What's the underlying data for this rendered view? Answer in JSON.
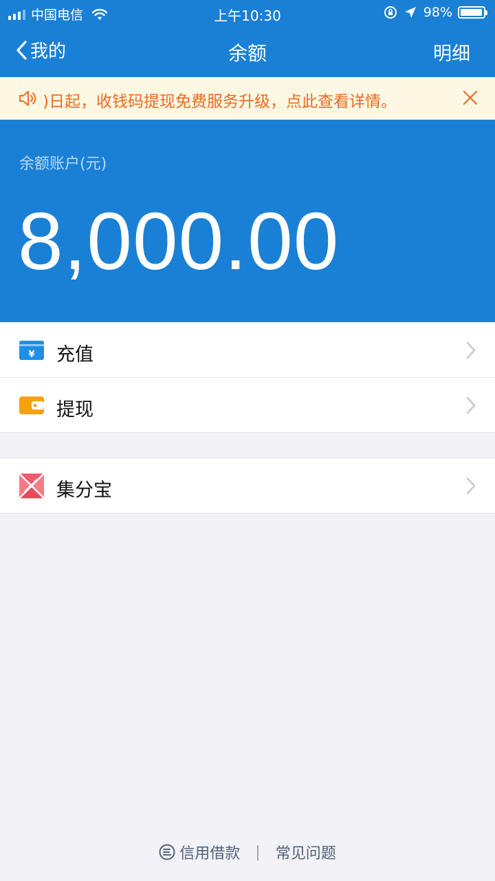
{
  "status_bar": {
    "carrier": "中国电信",
    "time": "上午10:30",
    "battery": "98%"
  },
  "nav": {
    "back_label": "我的",
    "title": "余额",
    "right_label": "明细"
  },
  "notice": {
    "text": ")日起，收钱码提现免费服务升级，点此查看详情。"
  },
  "balance": {
    "label": "余额账户(元)",
    "amount": "8,000.00"
  },
  "list_group_1": [
    {
      "label": "充值",
      "icon": "recharge-card-icon"
    },
    {
      "label": "提现",
      "icon": "wallet-icon"
    }
  ],
  "list_group_2": [
    {
      "label": "集分宝",
      "icon": "jifenbao-icon"
    }
  ],
  "footer": {
    "credit_label": "信用借款",
    "separator": "|",
    "faq_label": "常见问题"
  },
  "colors": {
    "primary": "#1a80d6",
    "notice_bg": "#fdf8e3",
    "notice_text": "#f06a1e",
    "background": "#f3f3f7"
  }
}
